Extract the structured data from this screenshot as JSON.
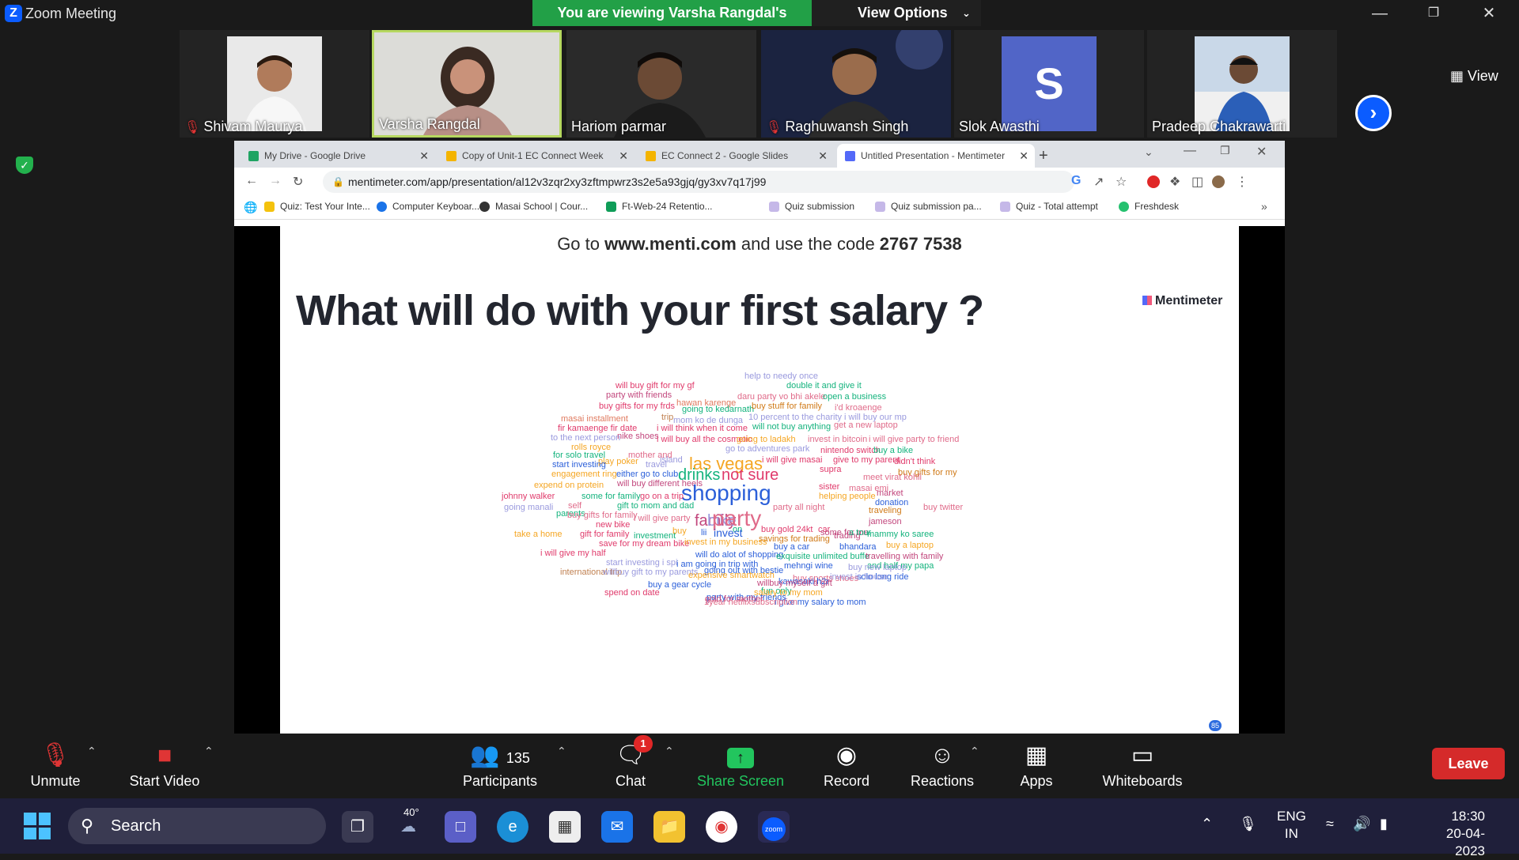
{
  "window": {
    "title": "Zoom Meeting",
    "viewing_banner": "You are viewing Varsha Rangdal's screen",
    "view_options": "View Options",
    "view_label": "View"
  },
  "gallery": [
    {
      "name": "Shivam Maurya",
      "muted": true
    },
    {
      "name": "Varsha Rangdal",
      "muted": false,
      "active": true
    },
    {
      "name": "Hariom parmar",
      "muted": false
    },
    {
      "name": "Raghuwansh Singh",
      "muted": true
    },
    {
      "name": "Slok Awasthi",
      "muted": false,
      "avatar_letter": "S",
      "avatar_color": "#5165c7"
    },
    {
      "name": "Pradeep Chakrawarti",
      "muted": false
    }
  ],
  "browser": {
    "tabs": [
      {
        "label": "My Drive - Google Drive",
        "icon_color": "#1fa463"
      },
      {
        "label": "Copy of Unit-1 EC Connect Week",
        "icon_color": "#f4b400"
      },
      {
        "label": "EC Connect 2 - Google Slides",
        "icon_color": "#f4b400"
      },
      {
        "label": "Untitled Presentation - Mentimeter",
        "icon_color": "#5369f8"
      }
    ],
    "url": "mentimeter.com/app/presentation/al12v3zqr2xy3zftmpwrz3s2e5a93gjq/gy3xv7q17j99",
    "bookmarks": [
      {
        "label": "Quiz: Test Your Inte...",
        "icon_color": "#f4c20d"
      },
      {
        "label": "Computer Keyboar...",
        "icon_color": "#1a73e8"
      },
      {
        "label": "Masai School | Cour...",
        "icon_color": "#333333"
      },
      {
        "label": "Ft-Web-24 Retentio...",
        "icon_color": "#0f9d58"
      },
      {
        "label": "Quiz submission",
        "icon_color": "#7e57c2"
      },
      {
        "label": "Quiz submission pa...",
        "icon_color": "#7e57c2"
      },
      {
        "label": "Quiz - Total attempt",
        "icon_color": "#7e57c2"
      },
      {
        "label": "Freshdesk",
        "icon_color": "#25c16f"
      }
    ]
  },
  "slide": {
    "go_prefix": "Go to ",
    "go_site": "www.menti.com",
    "go_mid": " and use the code ",
    "go_code": "2767 7538",
    "question": "What will do with your first salary ?",
    "brand": "Mentimeter",
    "responses_count": "85",
    "words": [
      {
        "t": "help to needy once",
        "c": "#9a9ade"
      },
      {
        "t": "will buy gift for my gf",
        "c": "#e03a6b"
      },
      {
        "t": "double it and give it",
        "c": "#14b37d"
      },
      {
        "t": "party with friends",
        "c": "#c2477d"
      },
      {
        "t": "daru party vo bhi akele",
        "c": "#e06b8a"
      },
      {
        "t": "open a business",
        "c": "#14b37d"
      },
      {
        "t": "hawan karenge",
        "c": "#e07a5f"
      },
      {
        "t": "buy gifts for my frds",
        "c": "#e03a6b"
      },
      {
        "t": "going to kedarnath",
        "c": "#14b37d"
      },
      {
        "t": "buy stuff for family",
        "c": "#d07a18"
      },
      {
        "t": "i'd kroaenge",
        "c": "#e06b8a"
      },
      {
        "t": "masai installment",
        "c": "#e07a5f"
      },
      {
        "t": "trip",
        "c": "#c08050"
      },
      {
        "t": "mom ko de dunga",
        "c": "#9a9ade"
      },
      {
        "t": "10 percent to the charity",
        "c": "#9a9ade"
      },
      {
        "t": "i will buy our mp",
        "c": "#9a9ade"
      },
      {
        "t": "fir kamaenge fir date",
        "c": "#e03a6b"
      },
      {
        "t": "nike shoes",
        "c": "#c2477d"
      },
      {
        "t": "i will think when it come",
        "c": "#e03a6b"
      },
      {
        "t": "will not buy anything",
        "c": "#14b37d"
      },
      {
        "t": "get a new laptop",
        "c": "#e06b8a"
      },
      {
        "t": "to the next person",
        "c": "#9a9ade"
      },
      {
        "t": "i will buy all the cosmetic",
        "c": "#e03a6b"
      },
      {
        "t": "going to ladakh",
        "c": "#f5a623"
      },
      {
        "t": "invest in bitcoin",
        "c": "#e06b8a"
      },
      {
        "t": "i will give party to friend",
        "c": "#e06b8a"
      },
      {
        "t": "rolls royce",
        "c": "#f5a623"
      },
      {
        "t": "play poker",
        "c": "#f5a623"
      },
      {
        "t": "go to adventures park",
        "c": "#9a9ade"
      },
      {
        "t": "nintendo switch",
        "c": "#e03a6b"
      },
      {
        "t": "buy a bike",
        "c": "#14b37d"
      },
      {
        "t": "for solo travel",
        "c": "#14b37d"
      },
      {
        "t": "mother and",
        "c": "#e06b8a"
      },
      {
        "t": "island",
        "c": "#9a9ade"
      },
      {
        "t": "las vegas",
        "c": "#f5a623"
      },
      {
        "t": "i will give masai",
        "c": "#e03a6b"
      },
      {
        "t": "give to my parent",
        "c": "#e03a6b"
      },
      {
        "t": "didn't think",
        "c": "#e03a6b"
      },
      {
        "t": "start investing",
        "c": "#2b5fd9"
      },
      {
        "t": "travel",
        "c": "#9a9ade"
      },
      {
        "t": "supra",
        "c": "#e03a6b"
      },
      {
        "t": "buy gifts for my",
        "c": "#d07a18"
      },
      {
        "t": "engagement ring",
        "c": "#f5a623"
      },
      {
        "t": "either go to club",
        "c": "#2b5fd9"
      },
      {
        "t": "drinks",
        "c": "#14b37d"
      },
      {
        "t": "not sure",
        "c": "#e03a6b"
      },
      {
        "t": "meet virat kohli",
        "c": "#e06b8a"
      },
      {
        "t": "expend on protein",
        "c": "#f5a623"
      },
      {
        "t": "will buy different heels",
        "c": "#c2477d"
      },
      {
        "t": "shopping",
        "c": "#2b5fd9"
      },
      {
        "t": "sister",
        "c": "#e03a6b"
      },
      {
        "t": "masai emi",
        "c": "#e06b8a"
      },
      {
        "t": "johnny walker",
        "c": "#e03a6b"
      },
      {
        "t": "some for family",
        "c": "#14b37d"
      },
      {
        "t": "go on a trip",
        "c": "#e03a6b"
      },
      {
        "t": "helping people",
        "c": "#f5a623"
      },
      {
        "t": "market",
        "c": "#c2477d"
      },
      {
        "t": "self",
        "c": "#e06b8a"
      },
      {
        "t": "gift to mom and dad",
        "c": "#14b37d"
      },
      {
        "t": "donation",
        "c": "#2b5fd9"
      },
      {
        "t": "going manali",
        "c": "#9a9ade"
      },
      {
        "t": "parents",
        "c": "#14b37d"
      },
      {
        "t": "buy gifts for family",
        "c": "#e06b8a"
      },
      {
        "t": "family",
        "c": "#c2477d"
      },
      {
        "t": "bike",
        "c": "#9a9ade"
      },
      {
        "t": "party",
        "c": "#e06b8a"
      },
      {
        "t": "party all night",
        "c": "#e06b8a"
      },
      {
        "t": "traveling",
        "c": "#d07a18"
      },
      {
        "t": "buy twitter",
        "c": "#e06b8a"
      },
      {
        "t": "new bike",
        "c": "#e03a6b"
      },
      {
        "t": "i will give party",
        "c": "#e06b8a"
      },
      {
        "t": "jameson",
        "c": "#c2477d"
      },
      {
        "t": "on",
        "c": "#14b37d"
      },
      {
        "t": "buy gold 24kt",
        "c": "#e03a6b"
      },
      {
        "t": "car",
        "c": "#e03a6b"
      },
      {
        "t": "take a home",
        "c": "#f5a623"
      },
      {
        "t": "gift for family",
        "c": "#e03a6b"
      },
      {
        "t": "investment",
        "c": "#14b37d"
      },
      {
        "t": "buy",
        "c": "#f5a623"
      },
      {
        "t": "lii",
        "c": "#2b5fd9"
      },
      {
        "t": "invest",
        "c": "#2b5fd9"
      },
      {
        "t": "savings for trading",
        "c": "#d07a18"
      },
      {
        "t": "some for me",
        "c": "#c2477d"
      },
      {
        "t": "trading",
        "c": "#c2477d"
      },
      {
        "t": "a tour",
        "c": "#14b37d"
      },
      {
        "t": "mammy ko saree",
        "c": "#14b37d"
      },
      {
        "t": "save for my dream bike",
        "c": "#e03a6b"
      },
      {
        "t": "invest in my business",
        "c": "#f5a623"
      },
      {
        "t": "buy a car",
        "c": "#2b5fd9"
      },
      {
        "t": "bhandara",
        "c": "#2b5fd9"
      },
      {
        "t": "buy a laptop",
        "c": "#f5a623"
      },
      {
        "t": "i will give my half",
        "c": "#e03a6b"
      },
      {
        "t": "will do alot of shopping",
        "c": "#2b5fd9"
      },
      {
        "t": "exquisite unlimited buffe",
        "c": "#14b37d"
      },
      {
        "t": "travelling with family",
        "c": "#c2477d"
      },
      {
        "t": "start investing i spi",
        "c": "#9a9ade"
      },
      {
        "t": "i am going in trip with",
        "c": "#2b5fd9"
      },
      {
        "t": "mehngi wine",
        "c": "#2b5fd9"
      },
      {
        "t": "and half my papa",
        "c": "#14b37d"
      },
      {
        "t": "international trip",
        "c": "#c08050"
      },
      {
        "t": "going out with bestie",
        "c": "#2b5fd9"
      },
      {
        "t": "buy sports shoes",
        "c": "#e06b8a"
      },
      {
        "t": "buy new laptop",
        "c": "#9a9ade"
      },
      {
        "t": "solo long ride",
        "c": "#2b5fd9"
      },
      {
        "t": "willbuy gift to my parents",
        "c": "#9a9ade"
      },
      {
        "t": "expensive smartwatch",
        "c": "#f5a623"
      },
      {
        "t": "kawasaki h2r",
        "c": "#2b5fd9"
      },
      {
        "t": "invest in house",
        "c": "#9a9ade"
      },
      {
        "t": "buy a gear cycle",
        "c": "#2b5fd9"
      },
      {
        "t": "willbuy myself a gift",
        "c": "#c2477d"
      },
      {
        "t": "party with my friends",
        "c": "#2b5fd9"
      },
      {
        "t": "fun only",
        "c": "#14b37d"
      },
      {
        "t": "spend on date",
        "c": "#e03a6b"
      },
      {
        "t": "gold for mother",
        "c": "#c2477d"
      },
      {
        "t": "salary to my mom",
        "c": "#f5a623"
      },
      {
        "t": "i give my salary to mom",
        "c": "#2b5fd9"
      },
      {
        "t": "1year netflixsubscription",
        "c": "#e06b8a"
      }
    ]
  },
  "toolbar": {
    "unmute": "Unmute",
    "start_video": "Start Video",
    "participants": "Participants",
    "participants_count": "135",
    "chat": "Chat",
    "chat_badge": "1",
    "share": "Share Screen",
    "record": "Record",
    "reactions": "Reactions",
    "apps": "Apps",
    "whiteboards": "Whiteboards",
    "leave": "Leave"
  },
  "taskbar": {
    "search": "Search",
    "weather_temp": "40°",
    "lang_line1": "ENG",
    "lang_line2": "IN",
    "time": "18:30",
    "date": "20-04-2023"
  }
}
